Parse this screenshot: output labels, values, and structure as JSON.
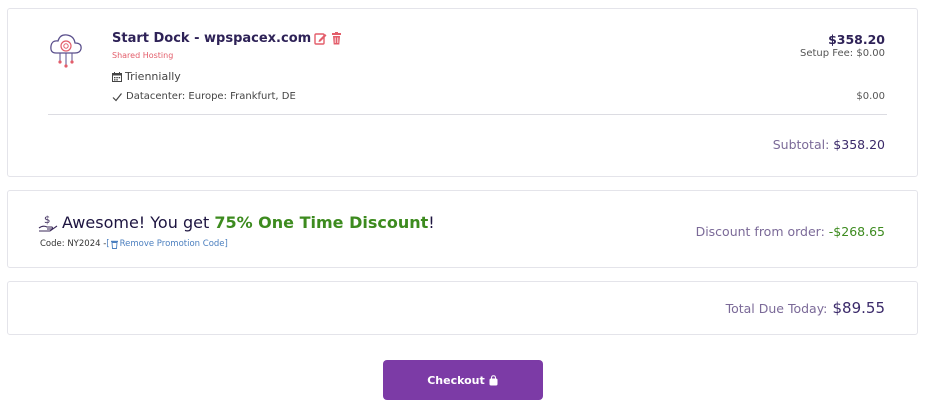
{
  "product": {
    "name": "Start Dock - wpspacex.com",
    "group": "Shared Hosting",
    "billing_cycle": "Triennially",
    "config_option": "Datacenter: Europe: Frankfurt, DE",
    "price": "$358.20",
    "setup_fee": "Setup Fee: $0.00",
    "config_price": "$0.00",
    "icon": "cloud-server-icon"
  },
  "subtotal": {
    "label": "Subtotal:",
    "value": "$358.20"
  },
  "discount": {
    "prefix": "Awesome! You get ",
    "highlight": "75% One Time Discount",
    "suffix": "!",
    "code_label": "Code: NY2024 - ",
    "remove_label": "Remove Promotion Code",
    "amount_label": "Discount from order:",
    "amount_value": "-$268.65"
  },
  "total": {
    "label": "Total Due Today:",
    "value": "$89.55"
  },
  "checkout": {
    "label": "Checkout"
  },
  "colors": {
    "accent": "#7c3ba6",
    "discount_green": "#3d8b1f",
    "danger": "#e35d6a",
    "link": "#4b7fbf"
  }
}
